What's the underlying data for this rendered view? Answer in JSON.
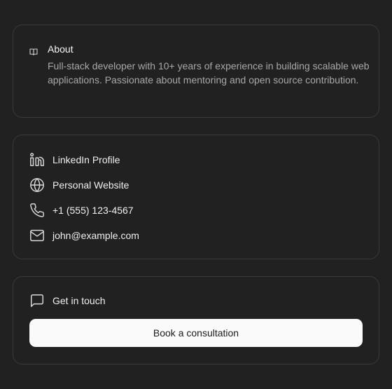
{
  "about": {
    "title": "About",
    "text": "Full-stack developer with 10+ years of experience in building scalable web applications. Passionate about mentoring and open source contribution.",
    "icon": "book-open-icon"
  },
  "contacts": [
    {
      "label": "LinkedIn Profile",
      "icon": "linkedin-icon"
    },
    {
      "label": "Personal Website",
      "icon": "globe-icon"
    },
    {
      "label": "+1 (555) 123-4567",
      "icon": "phone-icon"
    },
    {
      "label": "john@example.com",
      "icon": "mail-icon"
    }
  ],
  "cta": {
    "heading": "Get in touch",
    "icon": "message-square-icon",
    "button_label": "Book a consultation"
  },
  "colors": {
    "background": "#212121",
    "card_border": "#3a3a3a",
    "text_primary": "#f0f0f0",
    "text_muted": "#a8a8a8",
    "button_bg": "#fafafa",
    "button_text": "#1b1b1b"
  }
}
